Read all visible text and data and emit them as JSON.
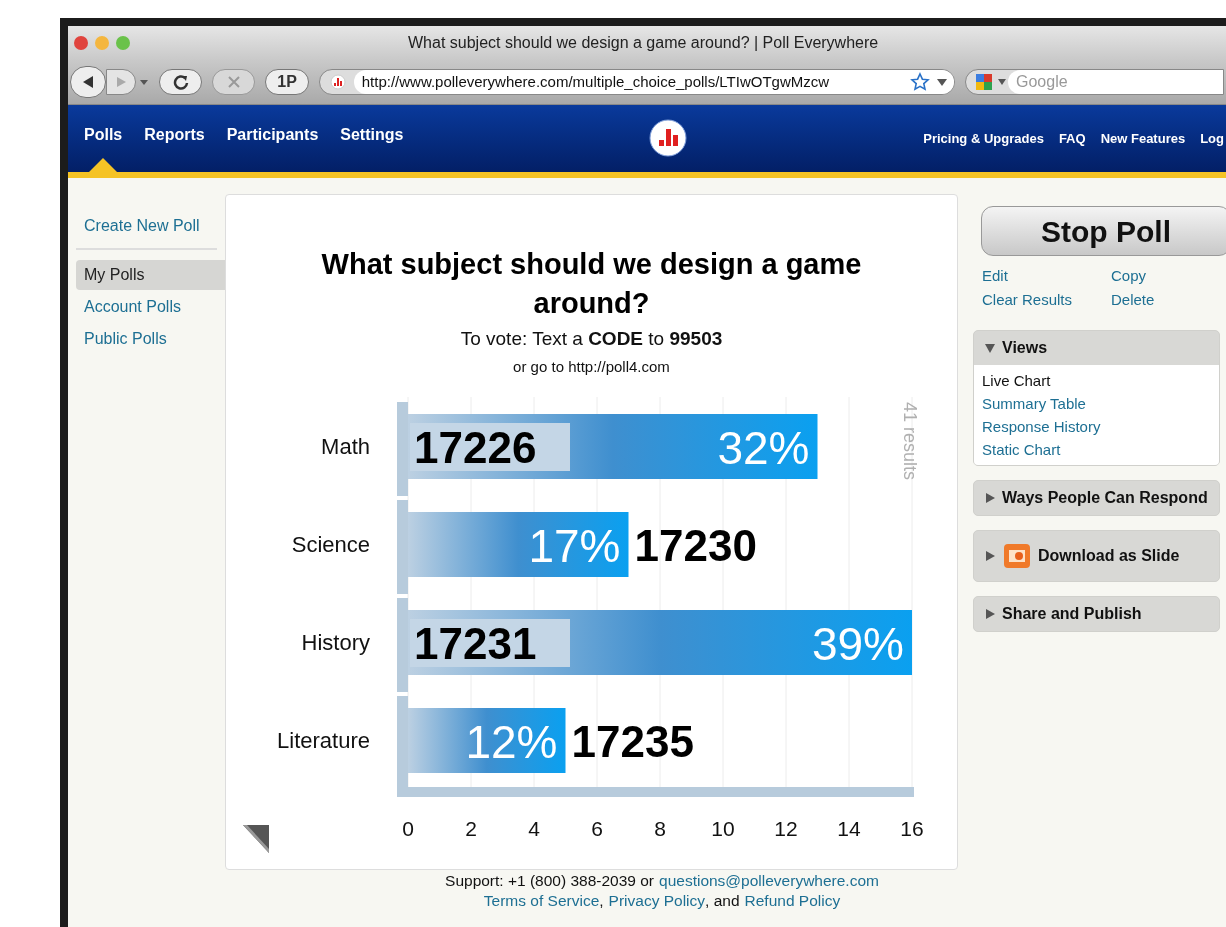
{
  "window": {
    "title": "What subject should we design a game around? | Poll Everywhere"
  },
  "toolbar": {
    "url": "http://www.polleverywhere.com/multiple_choice_polls/LTIwOTgwMzcw",
    "buttons": [
      {
        "label": "1P",
        "disabled": false
      }
    ],
    "stop_disabled": true,
    "search_placeholder": "Google"
  },
  "nav": {
    "items": [
      {
        "label": "Polls",
        "selected": true
      },
      {
        "label": "Reports",
        "selected": false
      },
      {
        "label": "Participants",
        "selected": false
      },
      {
        "label": "Settings",
        "selected": false
      }
    ],
    "right_links": [
      "Pricing & Upgrades",
      "FAQ",
      "New Features",
      "Log"
    ]
  },
  "sidebar": {
    "create": "Create New Poll",
    "items": [
      {
        "label": "My Polls",
        "selected": true
      },
      {
        "label": "Account Polls",
        "selected": false
      },
      {
        "label": "Public Polls",
        "selected": false
      }
    ]
  },
  "poll": {
    "title": "What subject should we design a game around?",
    "instruction": "To vote: Text a **CODE** to **99503**",
    "web": "or go to http://poll4.com",
    "codes": [
      "17226",
      "17230",
      "17231",
      "17235"
    ],
    "shares": [
      "32%",
      "17%",
      "39%",
      "12%"
    ],
    "chart_data": {
      "type": "bar",
      "orientation": "horizontal",
      "categories": [
        "Math",
        "Science",
        "History",
        "Literature"
      ],
      "values": [
        13,
        7,
        16,
        5
      ],
      "xlim": [
        0,
        16
      ],
      "xticks": [
        0,
        2,
        4,
        6,
        8,
        10,
        12,
        14,
        16
      ],
      "grid": true,
      "annotations": [
        "41 results"
      ]
    }
  },
  "actions": {
    "primary": "Stop Poll",
    "links": [
      "Edit",
      "Copy",
      "Clear Results",
      "Delete"
    ]
  },
  "panels": [
    {
      "title": "Views",
      "expanded": true,
      "items": [
        {
          "label": "Live Chart",
          "selected": true
        },
        {
          "label": "Summary Table",
          "selected": false
        },
        {
          "label": "Response History",
          "selected": false
        },
        {
          "label": "Static Chart",
          "selected": false
        }
      ]
    },
    {
      "title": "Ways People Can Respond",
      "expanded": false
    },
    {
      "title": "Download as Slide",
      "expanded": false,
      "kind": "slide"
    },
    {
      "title": "Share and Publish",
      "expanded": false
    }
  ],
  "footer": {
    "support": "Support: +1 (800) 388-2039 or",
    "email": "questions@polleverywhere.com",
    "links": [
      "Terms of Service",
      "Privacy Policy",
      "Refund Policy"
    ],
    "sep1": ",",
    "sep2": ", and"
  }
}
